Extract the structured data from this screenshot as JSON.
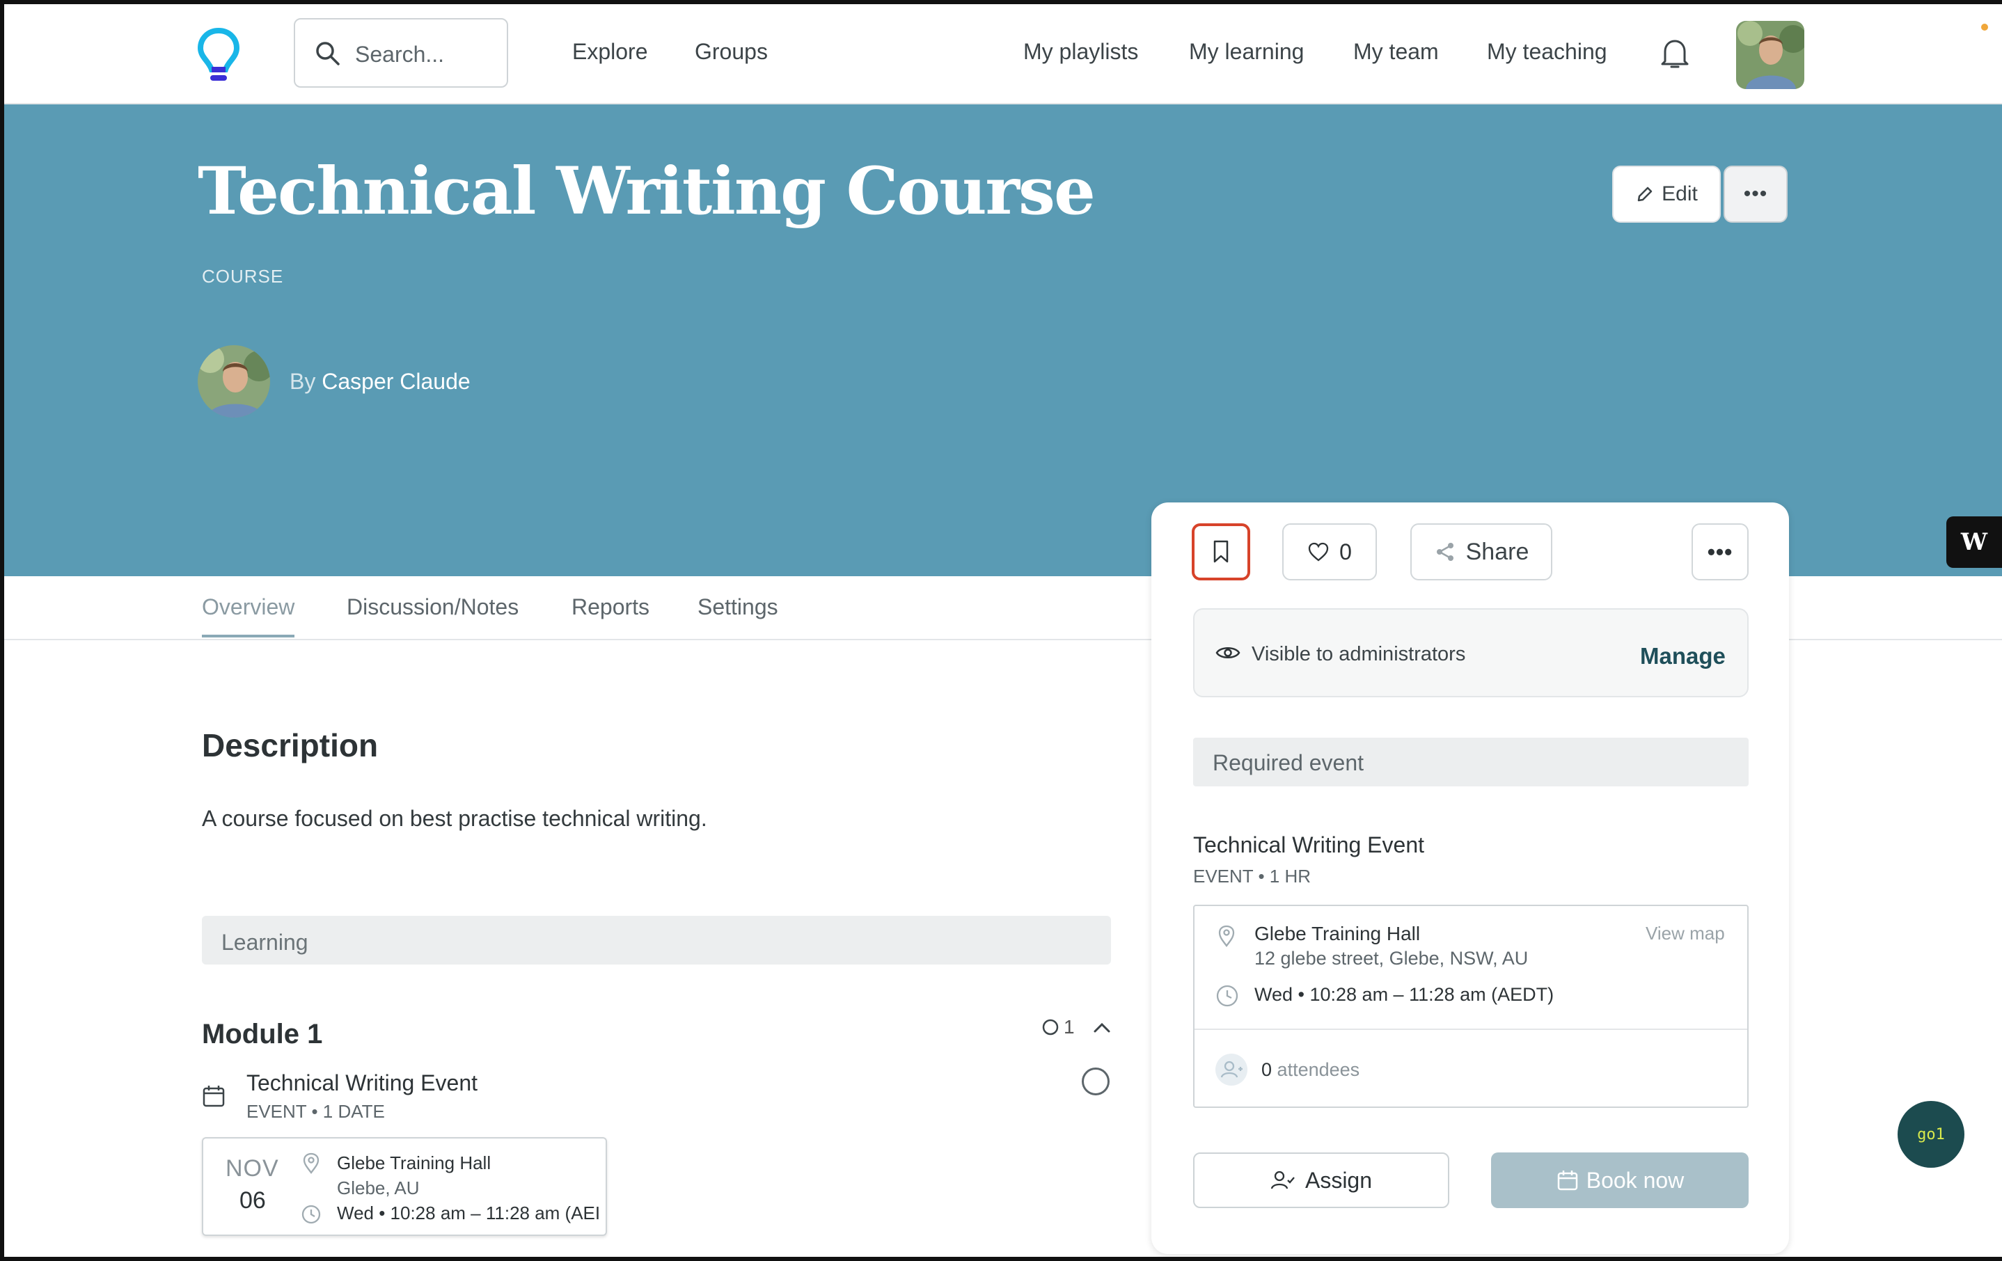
{
  "nav": {
    "search_placeholder": "Search...",
    "left_links": [
      "Explore",
      "Groups"
    ],
    "right_links": [
      "My playlists",
      "My learning",
      "My team",
      "My teaching"
    ],
    "icons": [
      "lightbulb-logo-icon",
      "search-icon",
      "bell-icon"
    ]
  },
  "hero": {
    "title": "Technical Writing Course",
    "type": "COURSE",
    "by": "By",
    "author": "Casper Claude",
    "edit_label": "Edit",
    "more_label": "•••",
    "background_color": "#5a9bb4"
  },
  "tabs": [
    "Overview",
    "Discussion/Notes",
    "Reports",
    "Settings"
  ],
  "description": {
    "heading": "Description",
    "text": "A course focused on best practise technical writing."
  },
  "learning": {
    "section_label": "Learning",
    "module_title": "Module 1",
    "module_count": "1",
    "item": {
      "title": "Technical Writing Event",
      "meta": "EVENT • 1 DATE",
      "month": "NOV",
      "day": "06",
      "venue": "Glebe Training Hall",
      "place": "Glebe, AU",
      "time": "Wed • 10:28 am – 11:28 am (AEI"
    }
  },
  "side": {
    "like_count": "0",
    "share_label": "Share",
    "more_label": "•••",
    "visibility_text": "Visible to administrators",
    "manage_label": "Manage",
    "required_label": "Required event",
    "event_title": "Technical Writing Event",
    "event_meta": "EVENT • 1 HR",
    "venue": "Glebe Training Hall",
    "address": "12 glebe street, Glebe, NSW, AU",
    "view_map": "View map",
    "time": "Wed • 10:28 am – 11:28 am (AEDT)",
    "attendee_count": "0",
    "attendees_label": "attendees",
    "assign_label": "Assign",
    "book_label": "Book now",
    "bookmark_highlight_color": "#d7432a"
  },
  "widgets": {
    "w_badge": "W",
    "go1_label": "go1"
  }
}
